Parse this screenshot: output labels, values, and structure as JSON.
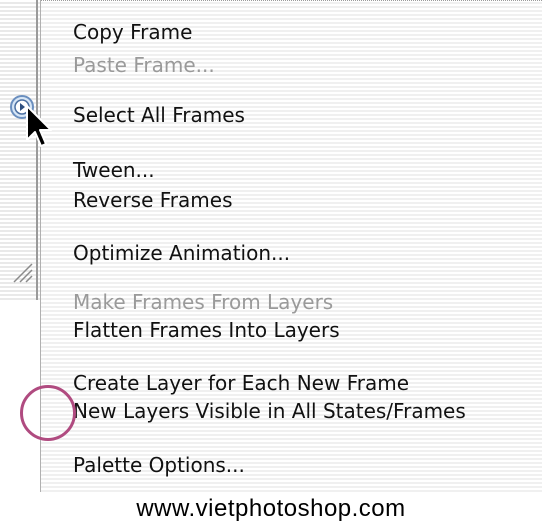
{
  "menu": {
    "items": [
      {
        "label": "Copy Frame",
        "enabled": true
      },
      {
        "label": "Paste Frame...",
        "enabled": false
      },
      {
        "label": "Select All Frames",
        "enabled": true
      },
      {
        "label": "Tween...",
        "enabled": true
      },
      {
        "label": "Reverse Frames",
        "enabled": true
      },
      {
        "label": "Optimize Animation...",
        "enabled": true
      },
      {
        "label": "Make Frames From Layers",
        "enabled": false
      },
      {
        "label": "Flatten Frames Into Layers",
        "enabled": true
      },
      {
        "label": "Create Layer for Each New Frame",
        "enabled": true
      },
      {
        "label": "New Layers Visible in All States/Frames",
        "enabled": true
      },
      {
        "label": "Palette Options...",
        "enabled": true
      }
    ]
  },
  "colors": {
    "highlight_circle": "#b04b80",
    "disabled_text": "#9a9a9a"
  },
  "icons": {
    "cursor": "arrow-pointer-icon",
    "palette_menu_button": "palette-menu-button-icon",
    "resize_grip": "resize-grip-icon"
  },
  "watermark": "www.vietphotoshop.com"
}
